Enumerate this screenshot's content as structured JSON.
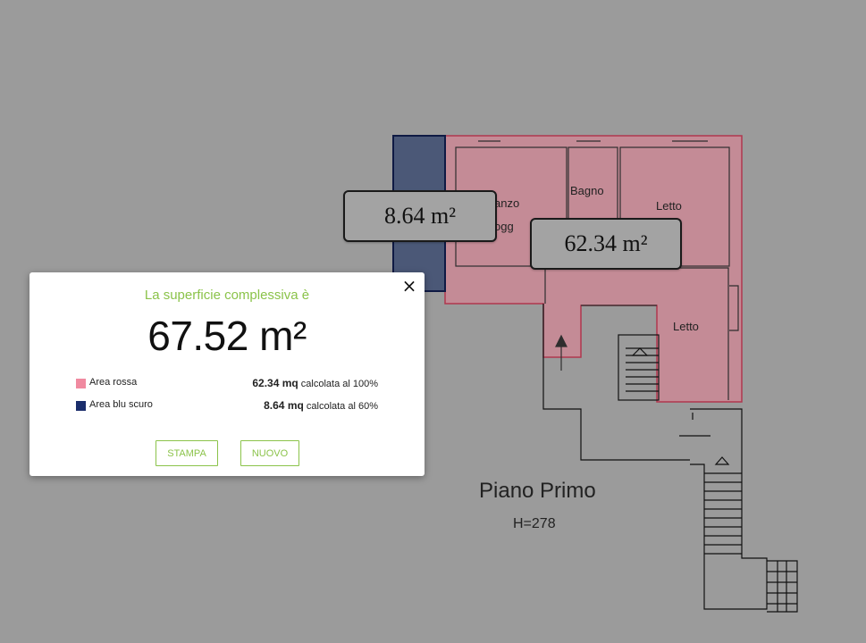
{
  "plan": {
    "rooms": [
      "anzo",
      "ogg",
      "Bagno",
      "Letto",
      "Letto"
    ],
    "floor_title": "Piano Primo",
    "floor_height": "H=278",
    "label_blue": "8.64 m²",
    "label_red": "62.34 m²"
  },
  "modal": {
    "title": "La superficie complessiva è",
    "total": "67.52 m²",
    "rows": [
      {
        "name": "Area rossa",
        "value": "62.34 mq",
        "suffix": " calcolata al 100%",
        "color": "#f08aa0"
      },
      {
        "name": "Area blu scuro",
        "value": "8.64 mq",
        "suffix": " calcolata al 60%",
        "color": "#1a2d6b"
      }
    ],
    "print_label": "STAMPA",
    "new_label": "NUOVO",
    "close_icon": "×"
  },
  "colors": {
    "accent": "#8bc34a",
    "red_area": "#c98a96",
    "blue_area": "#4b5877",
    "background": "#9b9b9b"
  }
}
